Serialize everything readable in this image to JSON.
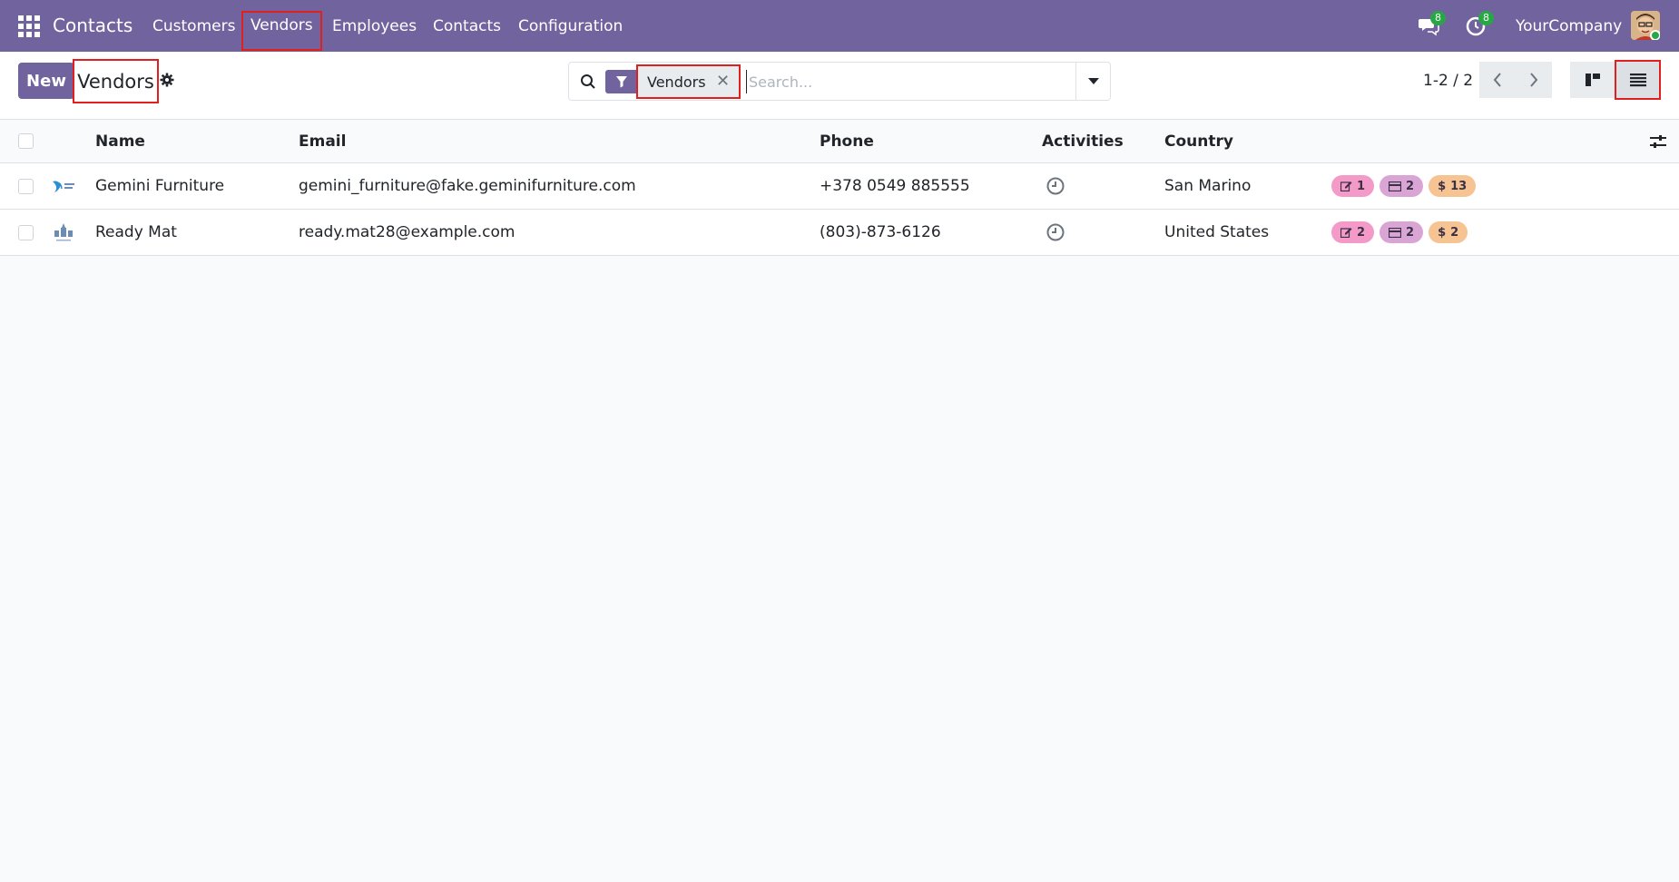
{
  "navbar": {
    "brand": "Contacts",
    "menu": [
      "Customers",
      "Vendors",
      "Employees",
      "Contacts",
      "Configuration"
    ],
    "messages_badge": "8",
    "activities_badge": "8",
    "company": "YourCompany"
  },
  "control": {
    "new_label": "New",
    "breadcrumb": "Vendors",
    "search": {
      "facet": "Vendors",
      "placeholder": "Search..."
    },
    "pager": "1-2 / 2"
  },
  "table": {
    "headers": [
      "Name",
      "Email",
      "Phone",
      "Activities",
      "Country"
    ],
    "rows": [
      {
        "name": "Gemini Furniture",
        "email": "gemini_furniture@fake.geminifurniture.com",
        "phone": "+378 0549 885555",
        "country": "San Marino",
        "stats": [
          "1",
          "2",
          "13"
        ]
      },
      {
        "name": "Ready Mat",
        "email": "ready.mat28@example.com",
        "phone": "(803)-873-6126",
        "country": "United States",
        "stats": [
          "2",
          "2",
          "2"
        ]
      }
    ]
  },
  "colors": {
    "primary": "#71639e",
    "highlight": "#e0201f",
    "badge": "#28a745"
  }
}
